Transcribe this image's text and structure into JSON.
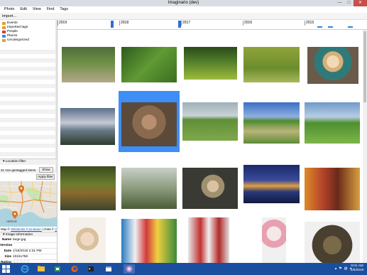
{
  "window": {
    "title": "Imaginario (dev)",
    "minimize": "—",
    "maximize": "□",
    "close": "✕"
  },
  "menu": [
    "Photo",
    "Edit",
    "View",
    "Find",
    "Tags"
  ],
  "toolbar": {
    "import_label": "Import..."
  },
  "tags": [
    {
      "label": "Events",
      "icon_color": "#e0a030"
    },
    {
      "label": "Imported tags",
      "icon_color": "#e0a030"
    },
    {
      "label": "People",
      "icon_color": "#d44040"
    },
    {
      "label": "Places",
      "icon_color": "#3a8fdc"
    },
    {
      "label": "Uncategorized",
      "icon_color": "#e0a030"
    }
  ],
  "location_filter": {
    "header": "Location filter",
    "status": "21 non geotagged items",
    "show_label": "Show",
    "apply_label": "Apply filter"
  },
  "map": {
    "city_label": "Helsinki",
    "credit_prefix": "Map ©",
    "credit_link": "WikiMedia Foundation",
    "credit_suffix": "| Data ©",
    "credit_link2": "Op"
  },
  "image_info": {
    "header": "Image information",
    "fields": [
      {
        "key": "Name",
        "value": "large.jpg"
      },
      {
        "key": "Version",
        "value": ""
      },
      {
        "key": "Date",
        "value": "1/18/2018 2:31 PM"
      },
      {
        "key": "Size",
        "value": "1024x758"
      },
      {
        "key": "Rating",
        "value": "☆☆☆☆☆"
      }
    ]
  },
  "timeline": {
    "years": [
      "2019",
      "2018",
      "2017",
      "2016",
      "2015"
    ]
  },
  "photos": [
    {
      "desc": "meadow path with tree",
      "grad": "linear-gradient(180deg,#4d6e3a 0%,#6f8f46 45%,#b4a888 100%)"
    },
    {
      "desc": "grass closeup",
      "grad": "linear-gradient(135deg,#2f5a1d,#5f9a34,#3c6d22)"
    },
    {
      "desc": "green field under trees",
      "grad": "linear-gradient(180deg,#2b4a19 0%,#4c7a28 40%,#9dbb3c 100%)"
    },
    {
      "desc": "sunlit grass",
      "grad": "linear-gradient(180deg,#8fa43a,#6c8d2d 60%,#a8b75a)"
    },
    {
      "desc": "portrait blonde woman",
      "grad": "radial-gradient(circle at 50% 40%,#f1d9b3 0 18%,#d8b07a 19% 30%,#2f7a78 31% 55%,#6a5a4a 56%)"
    },
    {
      "desc": "misty coast",
      "grad": "linear-gradient(180deg,#5b6f8a 0%,#c5c9d6 40%,#6a7a88 60%,#2d3a2d 100%)"
    },
    {
      "desc": "tabby cat",
      "grad": "radial-gradient(circle at 50% 45%,#b89070 0 20%,#8a6a4e 21% 45%,#5b4a3a 46%)"
    },
    {
      "desc": "green fields and sky",
      "grad": "linear-gradient(180deg,#9fb0b8 0%,#c9d3d8 35%,#5f8f3a 45%,#7fa84a 100%)"
    },
    {
      "desc": "dirt road through fields",
      "grad": "linear-gradient(180deg,#3b6fc4 0%,#8fb0e0 35%,#4f8a2f 45%,#b9b47a 70%,#5e8c36 100%)"
    },
    {
      "desc": "green hillside and sky",
      "grad": "linear-gradient(180deg,#6f9ac8 0%,#b8cde4 35%,#4f8f2f 50%,#7db54a 100%)"
    },
    {
      "desc": "tree by lake",
      "grad": "linear-gradient(180deg,#3a4a1f 0%,#6b7d2e 40%,#8a6b2c 60%,#3c4430 100%)"
    },
    {
      "desc": "girl in misty park",
      "grad": "linear-gradient(180deg,#c9cfc7 0%,#8c9c7d 50%,#4a5c36 100%)"
    },
    {
      "desc": "fashion portrait dark",
      "grad": "radial-gradient(circle at 55% 45%,#d8c2a0 0 15%,#a09070 16% 30%,#3a3a34 31%)"
    },
    {
      "desc": "night city waterfront",
      "grad": "linear-gradient(180deg,#1a2a6a 0%,#3a4a9a 40%,#e0a040 55%,#2a3a7a 70%,#111a40 100%)"
    },
    {
      "desc": "two women with headwraps",
      "grad": "linear-gradient(90deg,#e08a2a 0%,#b0402a 35%,#6a2a1a 60%,#d8a040 100%)"
    },
    {
      "desc": "portrait with crown",
      "grad": "radial-gradient(circle at 50% 40%,#f0d8c4 0 18%,#d8c09a 19% 30%,#f5f0ea 31%)"
    },
    {
      "desc": "cosplay group",
      "grad": "linear-gradient(90deg,#2a7ac0 0%,#f0f0f0 25%,#d03a3a 45%,#f0d040 65%,#3a8a3a 100%)"
    },
    {
      "desc": "costumed group",
      "grad": "linear-gradient(90deg,#e8e8e8 0%,#c03030 30%,#f0f0f0 50%,#b02828 75%,#e0e0e0 100%)"
    },
    {
      "desc": "cosplayer with mask",
      "grad": "radial-gradient(circle at 50% 30%,#f4e8e8 0 18%,#e8a0b0 19% 35%,#f0f0f0 36%)"
    },
    {
      "desc": "fantasy costume",
      "grad": "radial-gradient(circle at 50% 50%,#7a6a4a 0 25%,#4a4030 26% 55%,#f0f0f0 56%)"
    }
  ]
}
